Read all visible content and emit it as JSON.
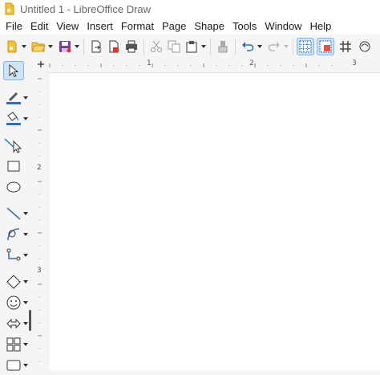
{
  "window": {
    "title": "Untitled 1 - LibreOffice Draw"
  },
  "menu": [
    "File",
    "Edit",
    "View",
    "Insert",
    "Format",
    "Page",
    "Shape",
    "Tools",
    "Window",
    "Help"
  ],
  "ruler": {
    "h_numbers": [
      "1",
      "2",
      "3"
    ],
    "v_numbers": [
      "2",
      "3"
    ]
  }
}
